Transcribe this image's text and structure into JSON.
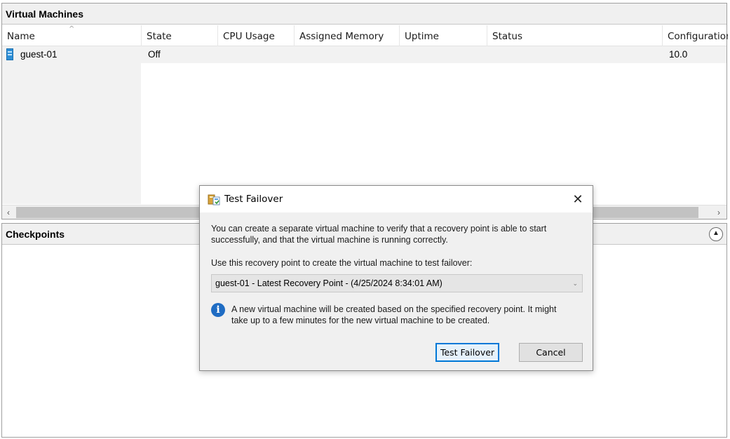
{
  "vm_pane": {
    "title": "Virtual Machines",
    "columns": [
      "Name",
      "State",
      "CPU Usage",
      "Assigned Memory",
      "Uptime",
      "Status",
      "Configuration"
    ],
    "rows": [
      {
        "name": "guest-01",
        "state": "Off",
        "cpu_usage": "",
        "assigned_memory": "",
        "uptime": "",
        "status": "",
        "configuration": "10.0",
        "icon": "vm-icon"
      }
    ],
    "scroll_left": "‹",
    "scroll_right": "›"
  },
  "checkpoints_pane": {
    "title": "Checkpoints",
    "collapse_icon": "▲"
  },
  "dialog": {
    "title": "Test Failover",
    "close_glyph": "✕",
    "intro_line1": "You can create a separate virtual machine to verify that a recovery point is able to start",
    "intro_line2": "successfully, and that the virtual machine is running correctly.",
    "select_label": "Use this recovery point to create the virtual machine to test failover:",
    "select_value": "guest-01 - Latest Recovery Point - (4/25/2024 8:34:01 AM)",
    "info_glyph": "i",
    "info_line1": "A new virtual machine will be created based on the specified recovery point. It might",
    "info_line2": "take up to a few minutes for the new virtual machine to be created.",
    "ok_button": "Test Failover",
    "cancel_button": "Cancel"
  },
  "colors": {
    "accent": "#0078d7",
    "info_blue": "#1f6cc3",
    "vm_icon_blue": "#2e8fd6"
  }
}
